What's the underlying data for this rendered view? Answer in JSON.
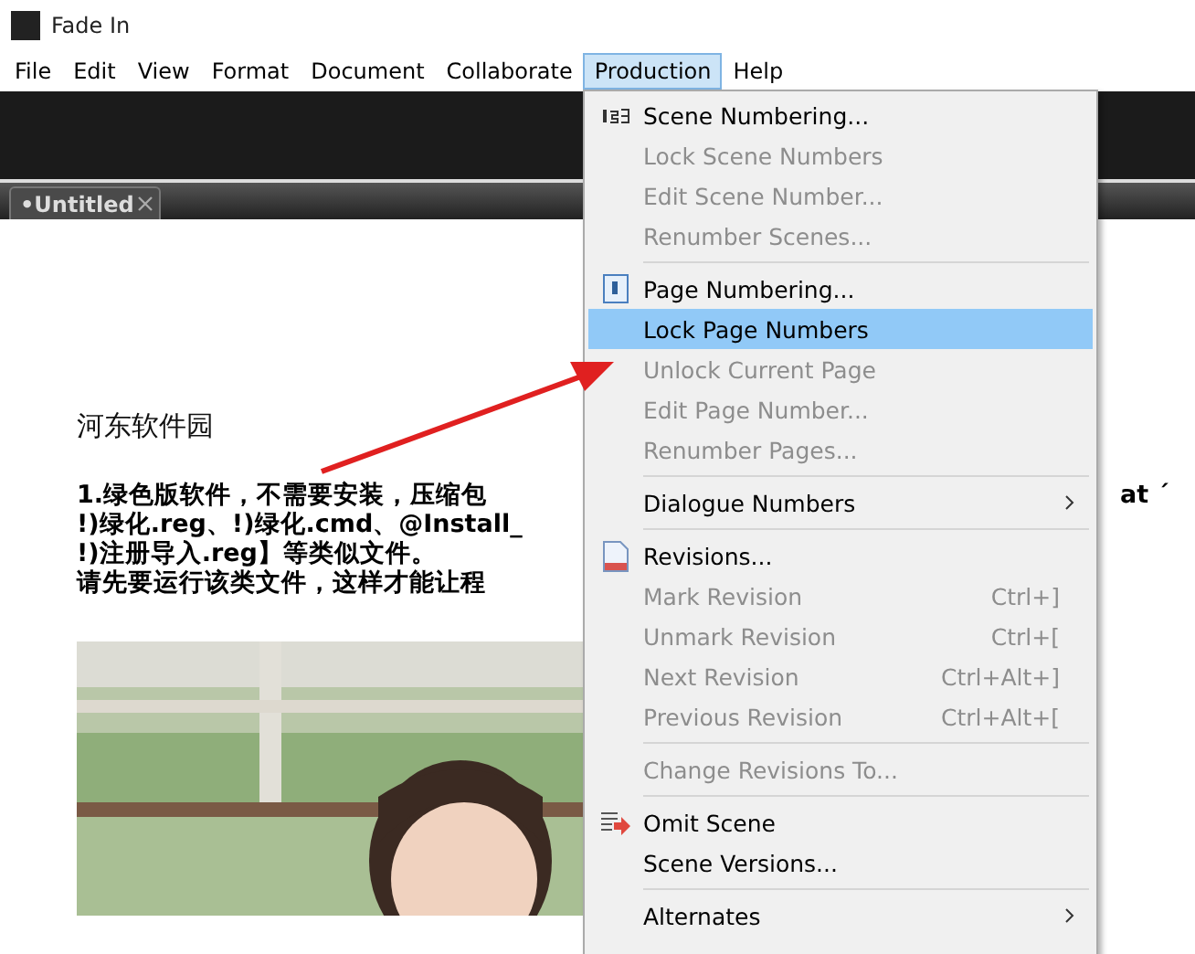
{
  "window": {
    "title": "Fade In"
  },
  "menubar": [
    {
      "label": "File",
      "selected": false
    },
    {
      "label": "Edit",
      "selected": false
    },
    {
      "label": "View",
      "selected": false
    },
    {
      "label": "Format",
      "selected": false
    },
    {
      "label": "Document",
      "selected": false
    },
    {
      "label": "Collaborate",
      "selected": false
    },
    {
      "label": "Production",
      "selected": true
    },
    {
      "label": "Help",
      "selected": false
    }
  ],
  "tabs": [
    {
      "label": "•Untitled",
      "selected": true
    }
  ],
  "document": {
    "heading": "河东软件园",
    "lines": [
      "1.绿色版软件，不需要安装，压缩包",
      "!)绿化.reg、!)绿化.cmd、@Install_",
      "!)注册导入.reg】等类似文件。",
      "请先要运行该类文件，这样才能让程"
    ],
    "line_tail": "at ´"
  },
  "menu": [
    {
      "kind": "item",
      "label": "Scene Numbering...",
      "disabled": false,
      "selected": false
    },
    {
      "kind": "item",
      "label": "Lock Scene Numbers",
      "disabled": true,
      "selected": false
    },
    {
      "kind": "item",
      "label": "Edit Scene Number...",
      "disabled": true,
      "selected": false
    },
    {
      "kind": "item",
      "label": "Renumber Scenes...",
      "disabled": true,
      "selected": false
    },
    {
      "kind": "separator"
    },
    {
      "kind": "item",
      "label": "Page Numbering...",
      "disabled": false,
      "selected": false
    },
    {
      "kind": "item",
      "label": "Lock Page Numbers",
      "disabled": false,
      "selected": true
    },
    {
      "kind": "item",
      "label": "Unlock Current Page",
      "disabled": true,
      "selected": false
    },
    {
      "kind": "item",
      "label": "Edit Page Number...",
      "disabled": true,
      "selected": false
    },
    {
      "kind": "item",
      "label": "Renumber Pages...",
      "disabled": true,
      "selected": false
    },
    {
      "kind": "separator"
    },
    {
      "kind": "item",
      "label": "Dialogue Numbers",
      "disabled": false,
      "selected": false,
      "submenu": true
    },
    {
      "kind": "separator"
    },
    {
      "kind": "item",
      "label": "Revisions...",
      "disabled": false,
      "selected": false
    },
    {
      "kind": "item",
      "label": "Mark Revision",
      "shortcut": "Ctrl+]",
      "disabled": true,
      "selected": false
    },
    {
      "kind": "item",
      "label": "Unmark Revision",
      "shortcut": "Ctrl+[",
      "disabled": true,
      "selected": false
    },
    {
      "kind": "item",
      "label": "Next Revision",
      "shortcut": "Ctrl+Alt+]",
      "disabled": true,
      "selected": false
    },
    {
      "kind": "item",
      "label": "Previous Revision",
      "shortcut": "Ctrl+Alt+[",
      "disabled": true,
      "selected": false
    },
    {
      "kind": "separator"
    },
    {
      "kind": "item",
      "label": "Change Revisions To...",
      "disabled": true,
      "selected": false
    },
    {
      "kind": "separator"
    },
    {
      "kind": "item",
      "label": "Omit Scene",
      "disabled": false,
      "selected": false
    },
    {
      "kind": "item",
      "label": "Scene Versions...",
      "disabled": false,
      "selected": false
    },
    {
      "kind": "separator"
    },
    {
      "kind": "item",
      "label": "Alternates",
      "disabled": false,
      "selected": false,
      "submenu": true
    }
  ]
}
